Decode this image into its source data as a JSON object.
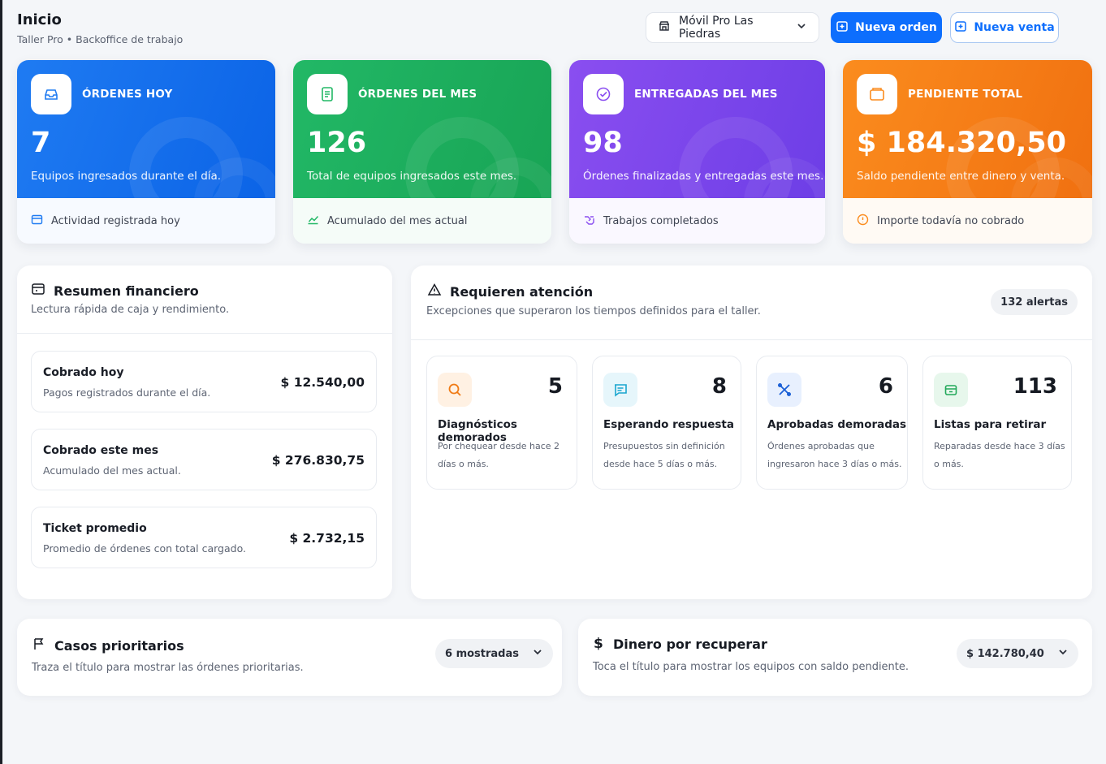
{
  "header": {
    "title": "Inicio",
    "subtitle": "Taller Pro • Backoffice de trabajo",
    "branch": "Móvil Pro Las Piedras",
    "new_order": "Nueva orden",
    "new_sale": "Nueva venta"
  },
  "kpis": [
    {
      "label": "ÓRDENES HOY",
      "value": "7",
      "desc": "Equipos ingresados durante el día.",
      "footer": "Actividad registrada hoy",
      "color": "#1f7bf2"
    },
    {
      "label": "ÓRDENES DEL MES",
      "value": "126",
      "desc": "Total de equipos ingresados este mes.",
      "footer": "Acumulado del mes actual",
      "color": "#22b866"
    },
    {
      "label": "ENTREGADAS DEL MES",
      "value": "98",
      "desc": "Órdenes finalizadas y entregadas este mes.",
      "footer": "Trabajos completados",
      "color": "#8a4ef0"
    },
    {
      "label": "PENDIENTE TOTAL",
      "value": "$ 184.320,50",
      "desc": "Saldo pendiente entre dinero y venta.",
      "footer": "Importe todavía no cobrado",
      "color": "#fb8c1e"
    }
  ],
  "financial": {
    "title": "Resumen financiero",
    "subtitle": "Lectura rápida de caja y rendimiento.",
    "rows": [
      {
        "label": "Cobrado hoy",
        "sub": "Pagos registrados durante el día.",
        "value": "$ 12.540,00"
      },
      {
        "label": "Cobrado este mes",
        "sub": "Acumulado del mes actual.",
        "value": "$ 276.830,75"
      },
      {
        "label": "Ticket promedio",
        "sub": "Promedio de órdenes con total cargado.",
        "value": "$ 2.732,15"
      }
    ]
  },
  "attention": {
    "title": "Requieren atención",
    "subtitle": "Excepciones que superaron los tiempos definidos para el taller.",
    "badge": "132 alertas",
    "cards": [
      {
        "count": "5",
        "title": "Diagnósticos demorados",
        "desc": "Por chequear desde hace 2 días o más.",
        "icon": "search-icon"
      },
      {
        "count": "8",
        "title": "Esperando respuesta",
        "desc": "Presupuestos sin definición desde hace 5 días o más.",
        "icon": "message-icon"
      },
      {
        "count": "6",
        "title": "Aprobadas demoradas",
        "desc": "Órdenes aprobadas que ingresaron hace 3 días o más.",
        "icon": "tools-icon"
      },
      {
        "count": "113",
        "title": "Listas para retirar",
        "desc": "Reparadas desde hace 3 días o más.",
        "icon": "package-icon"
      }
    ]
  },
  "priority": {
    "title": "Casos prioritarios",
    "subtitle": "Traza el título para mostrar las órdenes prioritarias.",
    "pill": "6 mostradas"
  },
  "recover": {
    "title": "Dinero por recuperar",
    "subtitle": "Toca el título para mostrar los equipos con saldo pendiente.",
    "pill": "$ 142.780,40"
  }
}
